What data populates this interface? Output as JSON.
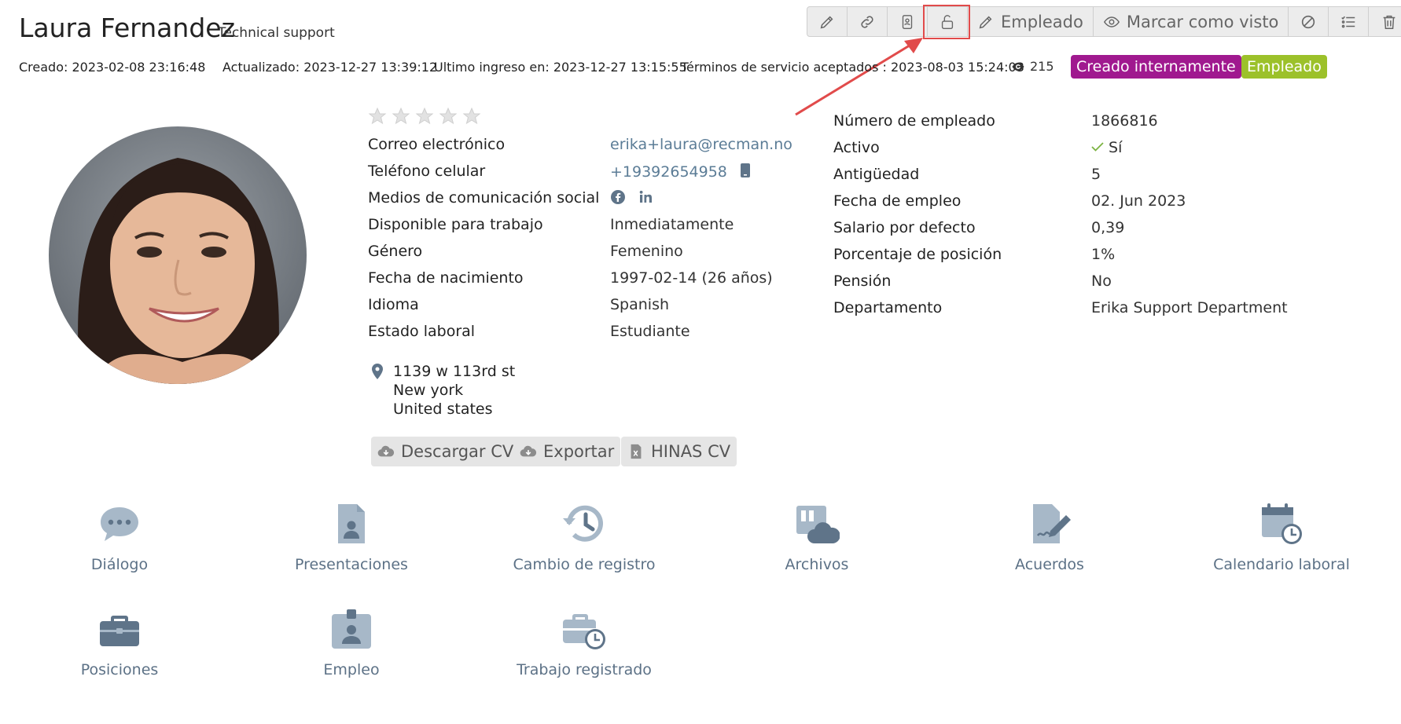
{
  "header": {
    "name": "Laura Fernandez",
    "role": "Technical support",
    "created": "Creado: 2023-02-08 23:16:48",
    "updated": "Actualizado: 2023-12-27 13:39:12",
    "last_login": "Ultimo ingreso en: 2023-12-27 13:15:55",
    "terms": "Términos de servicio aceptados : 2023-08-03 15:24:03",
    "views": "215",
    "badges": [
      {
        "label": "Creado internamente",
        "color": "#a0198f"
      },
      {
        "label": "Empleado",
        "color": "#9cc12a"
      }
    ]
  },
  "toolbar": {
    "icons": [
      "pencil-icon",
      "link-icon",
      "contact-card-icon",
      "unlock-icon",
      "pencil-icon",
      "eye-icon",
      "ban-icon",
      "list-settings-icon",
      "trash-icon"
    ],
    "employee_label": "Empleado",
    "mark_seen_label": "Marcar como visto"
  },
  "profile": {
    "rating": 0,
    "fields": [
      {
        "label": "Correo electrónico",
        "value": "erika+laura@recman.no"
      },
      {
        "label": "Teléfono celular",
        "value": "+19392654958"
      },
      {
        "label": "Medios de comunicación social",
        "value": ""
      },
      {
        "label": "Disponible para trabajo",
        "value": "Inmediatamente"
      },
      {
        "label": "Género",
        "value": "Femenino"
      },
      {
        "label": "Fecha de nacimiento",
        "value": "1997-02-14 (26 años)"
      },
      {
        "label": "Idioma",
        "value": "Spanish"
      },
      {
        "label": "Estado laboral",
        "value": "Estudiante"
      }
    ],
    "address": {
      "line1": "1139 w 113rd st",
      "line2": "New york",
      "line3": "United states"
    }
  },
  "actions": {
    "download_cv": "Descargar CV",
    "export": "Exportar",
    "hinas_cv": "HINAS CV"
  },
  "employment": {
    "fields": [
      {
        "label": "Número de empleado",
        "value": "1866816"
      },
      {
        "label": "Activo",
        "value": "Sí"
      },
      {
        "label": "Antigüedad",
        "value": "5"
      },
      {
        "label": "Fecha de empleo",
        "value": "02. Jun 2023"
      },
      {
        "label": "Salario por defecto",
        "value": "0,39"
      },
      {
        "label": "Porcentaje de posición",
        "value": "1%"
      },
      {
        "label": "Pensión",
        "value": "No"
      },
      {
        "label": "Departamento",
        "value": "Erika Support Department"
      }
    ]
  },
  "tiles": [
    {
      "label": "Diálogo",
      "icon": "chat-icon"
    },
    {
      "label": "Presentaciones",
      "icon": "document-person-icon"
    },
    {
      "label": "Cambio de registro",
      "icon": "history-icon"
    },
    {
      "label": "Archivos",
      "icon": "files-cloud-icon"
    },
    {
      "label": "Acuerdos",
      "icon": "contract-sign-icon"
    },
    {
      "label": "Calendario laboral",
      "icon": "calendar-clock-icon"
    },
    {
      "label": "Posiciones",
      "icon": "briefcase-icon"
    },
    {
      "label": "Empleo",
      "icon": "badge-person-icon"
    },
    {
      "label": "Trabajo registrado",
      "icon": "briefcase-clock-icon"
    }
  ],
  "colors": {
    "icon_dark": "#5f7489",
    "icon_light": "#a7b8c8",
    "link": "#5b7c96",
    "highlight": "#e14b4b"
  }
}
